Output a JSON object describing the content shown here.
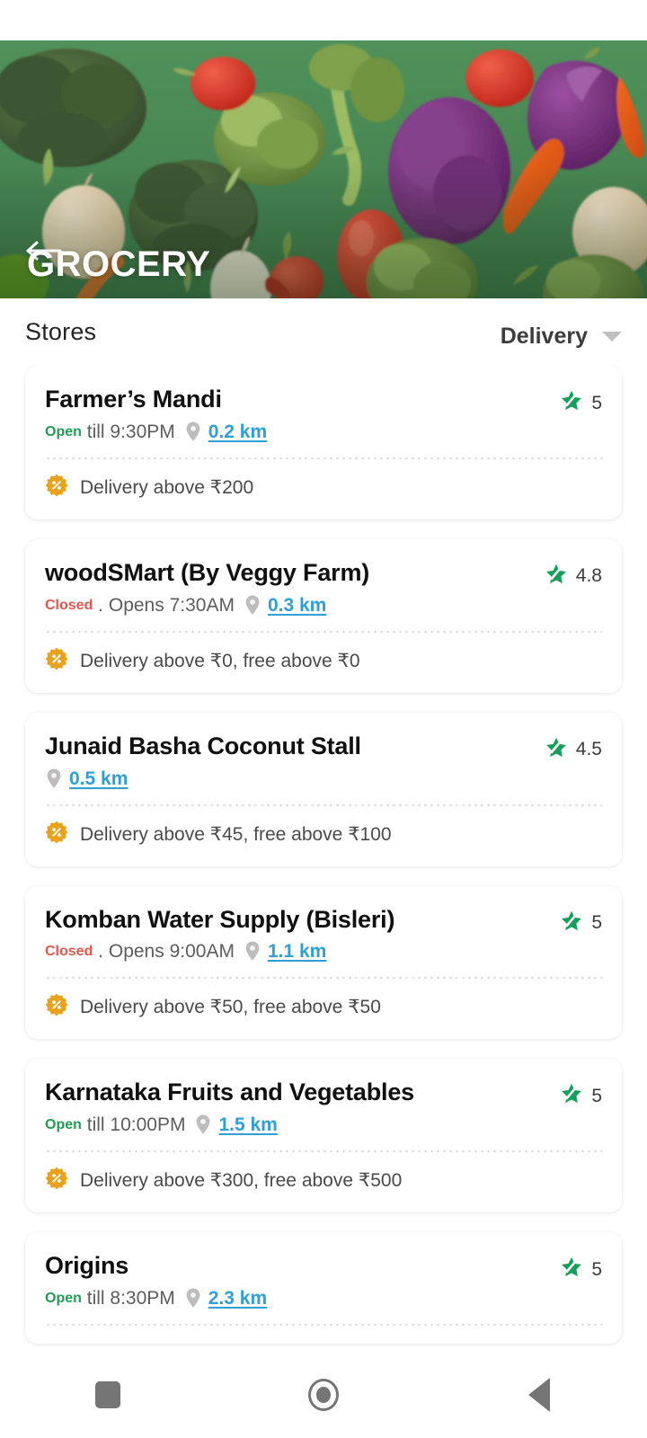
{
  "status_bar": {
    "visible": true
  },
  "hero": {
    "title": "GROCERY",
    "back_icon": "back-arrow-icon",
    "background_color": "#4b8a53"
  },
  "section": {
    "title": "Stores",
    "mode_label": "Delivery",
    "caret_icon": "chevron-down-icon"
  },
  "icons": {
    "rating_badge": "star-slash-icon",
    "offer_badge": "percent-badge-icon",
    "location_pin": "location-pin-icon"
  },
  "colors": {
    "open": "#1f9d55",
    "closed": "#e2574c",
    "link": "#2f9fd6",
    "rating_green": "#14a05a",
    "offer_orange": "#e9a21c"
  },
  "stores": [
    {
      "name": "Farmer’s Mandi",
      "status": "Open",
      "status_state": "open",
      "hours": "till 9:30PM",
      "separator": "",
      "distance": "0.2 km",
      "rating": "5",
      "offer": "Delivery above ₹200"
    },
    {
      "name": "woodSMart (By Veggy Farm)",
      "status": "Closed",
      "status_state": "closed",
      "hours": "Opens 7:30AM",
      "separator": " . ",
      "distance": "0.3 km",
      "rating": "4.8",
      "offer": "Delivery above ₹0, free above ₹0"
    },
    {
      "name": "Junaid Basha Coconut Stall",
      "status": "",
      "status_state": "none",
      "hours": "",
      "separator": "",
      "distance": "0.5 km",
      "rating": "4.5",
      "offer": "Delivery above ₹45, free above ₹100"
    },
    {
      "name": "Komban Water Supply (Bisleri)",
      "status": "Closed",
      "status_state": "closed",
      "hours": "Opens 9:00AM",
      "separator": " . ",
      "distance": "1.1 km",
      "rating": "5",
      "offer": "Delivery above ₹50, free above ₹50"
    },
    {
      "name": "Karnataka Fruits and Vegetables",
      "status": "Open",
      "status_state": "open",
      "hours": "till 10:00PM",
      "separator": "",
      "distance": "1.5 km",
      "rating": "5",
      "offer": "Delivery above ₹300, free above ₹500"
    },
    {
      "name": "Origins",
      "status": "Open",
      "status_state": "open",
      "hours": "till 8:30PM",
      "separator": "",
      "distance": "2.3 km",
      "rating": "5",
      "offer": ""
    }
  ],
  "navbar": {
    "recents_icon": "square-recents-icon",
    "home_icon": "circle-home-icon",
    "back_icon": "triangle-back-icon"
  }
}
